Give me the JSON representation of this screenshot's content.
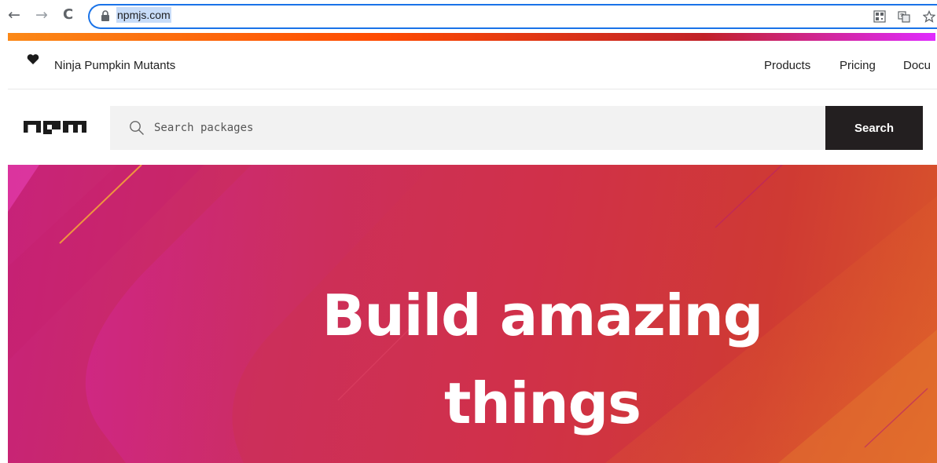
{
  "browser": {
    "back_glyph": "←",
    "forward_glyph": "→",
    "reload_glyph": "C",
    "url": "npmjs.com",
    "icons": [
      "back-arrow-icon",
      "forward-arrow-icon",
      "reload-icon",
      "lock-icon",
      "qr-code-icon",
      "translate-icon",
      "star-icon"
    ]
  },
  "header": {
    "tagline": "Ninja Pumpkin Mutants",
    "nav": [
      {
        "label": "Products"
      },
      {
        "label": "Pricing"
      },
      {
        "label": "Docu"
      }
    ]
  },
  "search": {
    "placeholder": "Search packages",
    "button_label": "Search"
  },
  "hero": {
    "line1": "Build amazing",
    "line2": "things"
  },
  "colors": {
    "stripe_start": "#fb8817",
    "stripe_end": "#e02aff",
    "hero_base": "#cf3a33",
    "search_button": "#231f20",
    "omnibox_border": "#1a73e8"
  }
}
